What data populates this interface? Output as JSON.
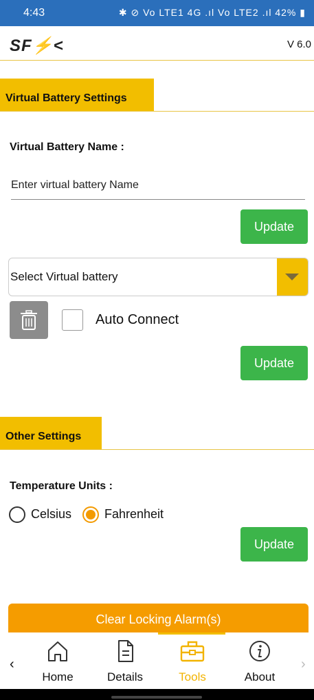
{
  "status_bar": {
    "time": "4:43",
    "icons_text": "✱ ⊘ Vo LTE1 4G .ıl Vo LTE2 .ıl",
    "battery": "42%"
  },
  "header": {
    "logo_text": "SF",
    "version": "V 6.0"
  },
  "virtual_battery": {
    "section_title": "Virtual Battery Settings",
    "name_label": "Virtual Battery Name :",
    "name_placeholder": "Enter virtual battery Name",
    "update_label": "Update",
    "select_value": "Select Virtual battery",
    "auto_connect_label": "Auto Connect",
    "auto_connect_checked": false,
    "update2_label": "Update"
  },
  "other_settings": {
    "section_title": "Other Settings",
    "temp_label": "Temperature Units :",
    "options": [
      {
        "label": "Celsius",
        "checked": false
      },
      {
        "label": "Fahrenheit",
        "checked": true
      }
    ],
    "update_label": "Update"
  },
  "clear_alarm_label": "Clear Locking Alarm(s)",
  "nav": {
    "items": [
      {
        "label": "Home",
        "icon": "home-icon"
      },
      {
        "label": "Details",
        "icon": "document-icon"
      },
      {
        "label": "Tools",
        "icon": "toolbox-icon",
        "active": true
      },
      {
        "label": "About",
        "icon": "info-icon"
      }
    ],
    "prev": "‹",
    "next": "›"
  },
  "colors": {
    "accent": "#f2be00",
    "button_green": "#3cb54a",
    "clear_orange": "#f59c00",
    "status_bar": "#2b6fbb"
  }
}
